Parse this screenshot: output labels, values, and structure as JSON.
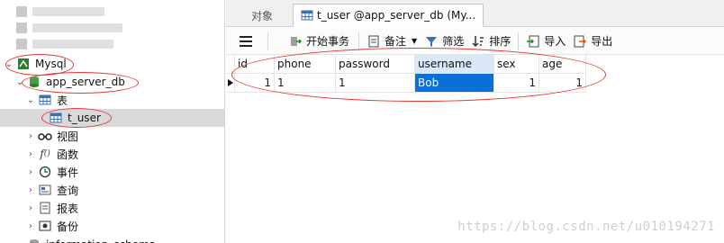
{
  "sidebar": {
    "connection": {
      "label": "Mysql"
    },
    "database": {
      "label": "app_server_db"
    },
    "tables_group": {
      "label": "表"
    },
    "table": {
      "label": "t_user"
    },
    "groups": [
      {
        "label": "视图",
        "icon": "glasses-icon"
      },
      {
        "label": "函数",
        "icon": "function-icon"
      },
      {
        "label": "事件",
        "icon": "clock-icon"
      },
      {
        "label": "查询",
        "icon": "query-icon"
      },
      {
        "label": "报表",
        "icon": "report-icon"
      },
      {
        "label": "备份",
        "icon": "backup-icon"
      }
    ],
    "partial_item": {
      "label": "information_schema"
    }
  },
  "tabs": {
    "objects": "对象",
    "active": "t_user @app_server_db (My..."
  },
  "toolbar": {
    "begin_transaction": "开始事务",
    "notes": "备注",
    "filter": "筛选",
    "sort": "排序",
    "import": "导入",
    "export": "导出"
  },
  "grid": {
    "columns": [
      "id",
      "phone",
      "password",
      "username",
      "sex",
      "age"
    ],
    "rows": [
      [
        "1",
        "1",
        "1",
        "Bob",
        "1",
        "1"
      ]
    ]
  },
  "watermark": "https://blog.csdn.net/u010194271",
  "colors": {
    "selection": "#0a6fd6",
    "annotation": "#e53935",
    "selected_column_header": "#dbe8f7"
  }
}
